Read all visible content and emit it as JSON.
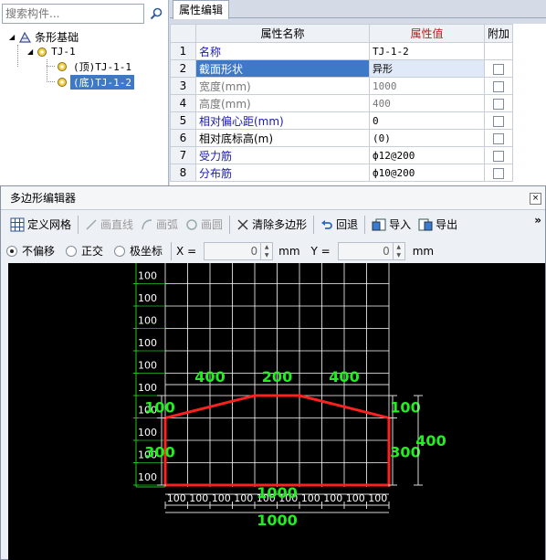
{
  "search": {
    "placeholder": "搜索构件..."
  },
  "tree": {
    "root": "条形基础",
    "group": "TJ-1",
    "items": [
      "(顶)TJ-1-1",
      "(底)TJ-1-2"
    ]
  },
  "tab": {
    "label": "属性编辑"
  },
  "props": {
    "headers": {
      "name": "属性名称",
      "value": "属性值",
      "extra": "附加"
    },
    "rows": [
      {
        "no": "1",
        "name": "名称",
        "value": "TJ-1-2"
      },
      {
        "no": "2",
        "name": "截面形状",
        "value": "异形"
      },
      {
        "no": "3",
        "name": "宽度(mm)",
        "value": "1000"
      },
      {
        "no": "4",
        "name": "高度(mm)",
        "value": "400"
      },
      {
        "no": "5",
        "name": "相对偏心距(mm)",
        "value": "0"
      },
      {
        "no": "6",
        "name": "相对底标高(m)",
        "value": "(0)"
      },
      {
        "no": "7",
        "name": "受力筋",
        "value": "ф12@200"
      },
      {
        "no": "8",
        "name": "分布筋",
        "value": "ф10@200"
      }
    ]
  },
  "dialog": {
    "title": "多边形编辑器",
    "close": "×",
    "toolbar": {
      "grid": "定义网格",
      "line": "画直线",
      "arc": "画弧",
      "circle": "画圆",
      "clear": "清除多边形",
      "undo": "回退",
      "import": "导入",
      "export": "导出",
      "more": "»"
    },
    "options": {
      "no_offset": "不偏移",
      "ortho": "正交",
      "polar": "极坐标",
      "x_label": "X =",
      "x_value": "0",
      "x_unit": "mm",
      "y_label": "Y =",
      "y_value": "0",
      "y_unit": "mm"
    }
  },
  "drawing": {
    "row_labels": [
      "100",
      "100",
      "100",
      "100",
      "100",
      "100",
      "100",
      "100",
      "100",
      "100",
      "100",
      "100"
    ],
    "col_labels": [
      "100",
      "100",
      "100",
      "100",
      "100",
      "100",
      "100",
      "100",
      "100",
      "100"
    ],
    "dims": {
      "top_left": "400",
      "top_mid": "200",
      "top_right": "400",
      "left_upper": "100",
      "left_lower": "300",
      "right_upper": "100",
      "right_lower": "300",
      "right_total": "400",
      "bottom": "1000",
      "bottom_total": "1000"
    },
    "colors": {
      "grid": "#ffffff",
      "axis": "#22c322",
      "shape": "#ff2020",
      "dim": "#22ee22",
      "dimline": "#d8d8d8"
    }
  }
}
